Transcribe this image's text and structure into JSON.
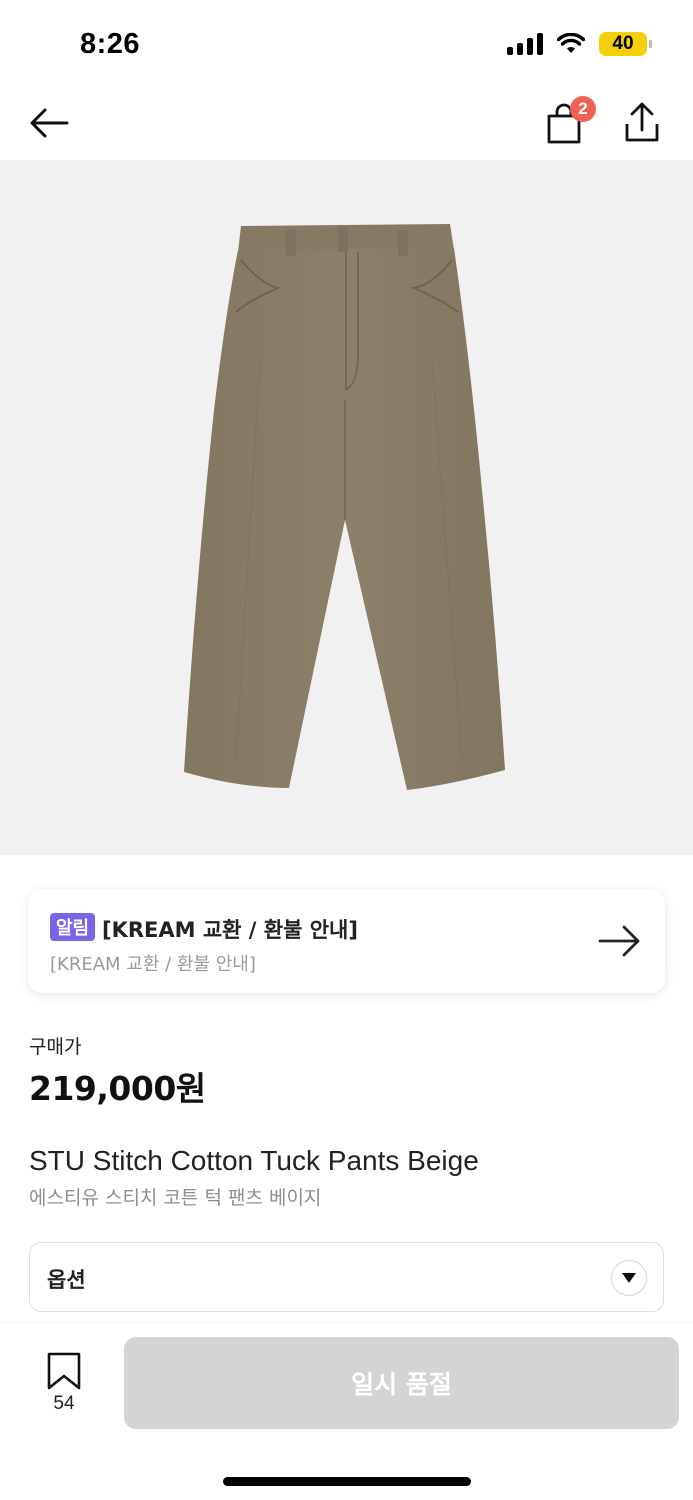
{
  "status_bar": {
    "time": "8:26",
    "battery": "40"
  },
  "nav": {
    "back_icon": "arrow-left-icon",
    "cart_icon": "shopping-bag-icon",
    "cart_badge": "2",
    "share_icon": "share-icon"
  },
  "product_image": {
    "subject": "beige-pants-image",
    "pants_color": "#8a7d66",
    "background": "#f1f1f1"
  },
  "notice": {
    "tag": "알림",
    "title": "[KREAM 교환 / 환불 안내]",
    "subtitle": "[KREAM 교환 / 환불 안내]",
    "tag_color": "#7b64e8",
    "arrow_icon": "arrow-right-icon"
  },
  "price": {
    "label": "구매가",
    "value": "219,000원"
  },
  "product": {
    "name": "STU Stitch Cotton Tuck Pants Beige",
    "name_ko": "에스티유 스티치 코튼 턱 팬츠 베이지"
  },
  "option": {
    "label": "옵션",
    "chevron_icon": "chevron-down-icon"
  },
  "bottom_bar": {
    "bookmark_icon": "bookmark-icon",
    "bookmark_count": "54",
    "soldout_label": "일시 품절"
  },
  "colors": {
    "badge": "#ef6253",
    "soldout_button": "#d4d4d4"
  }
}
